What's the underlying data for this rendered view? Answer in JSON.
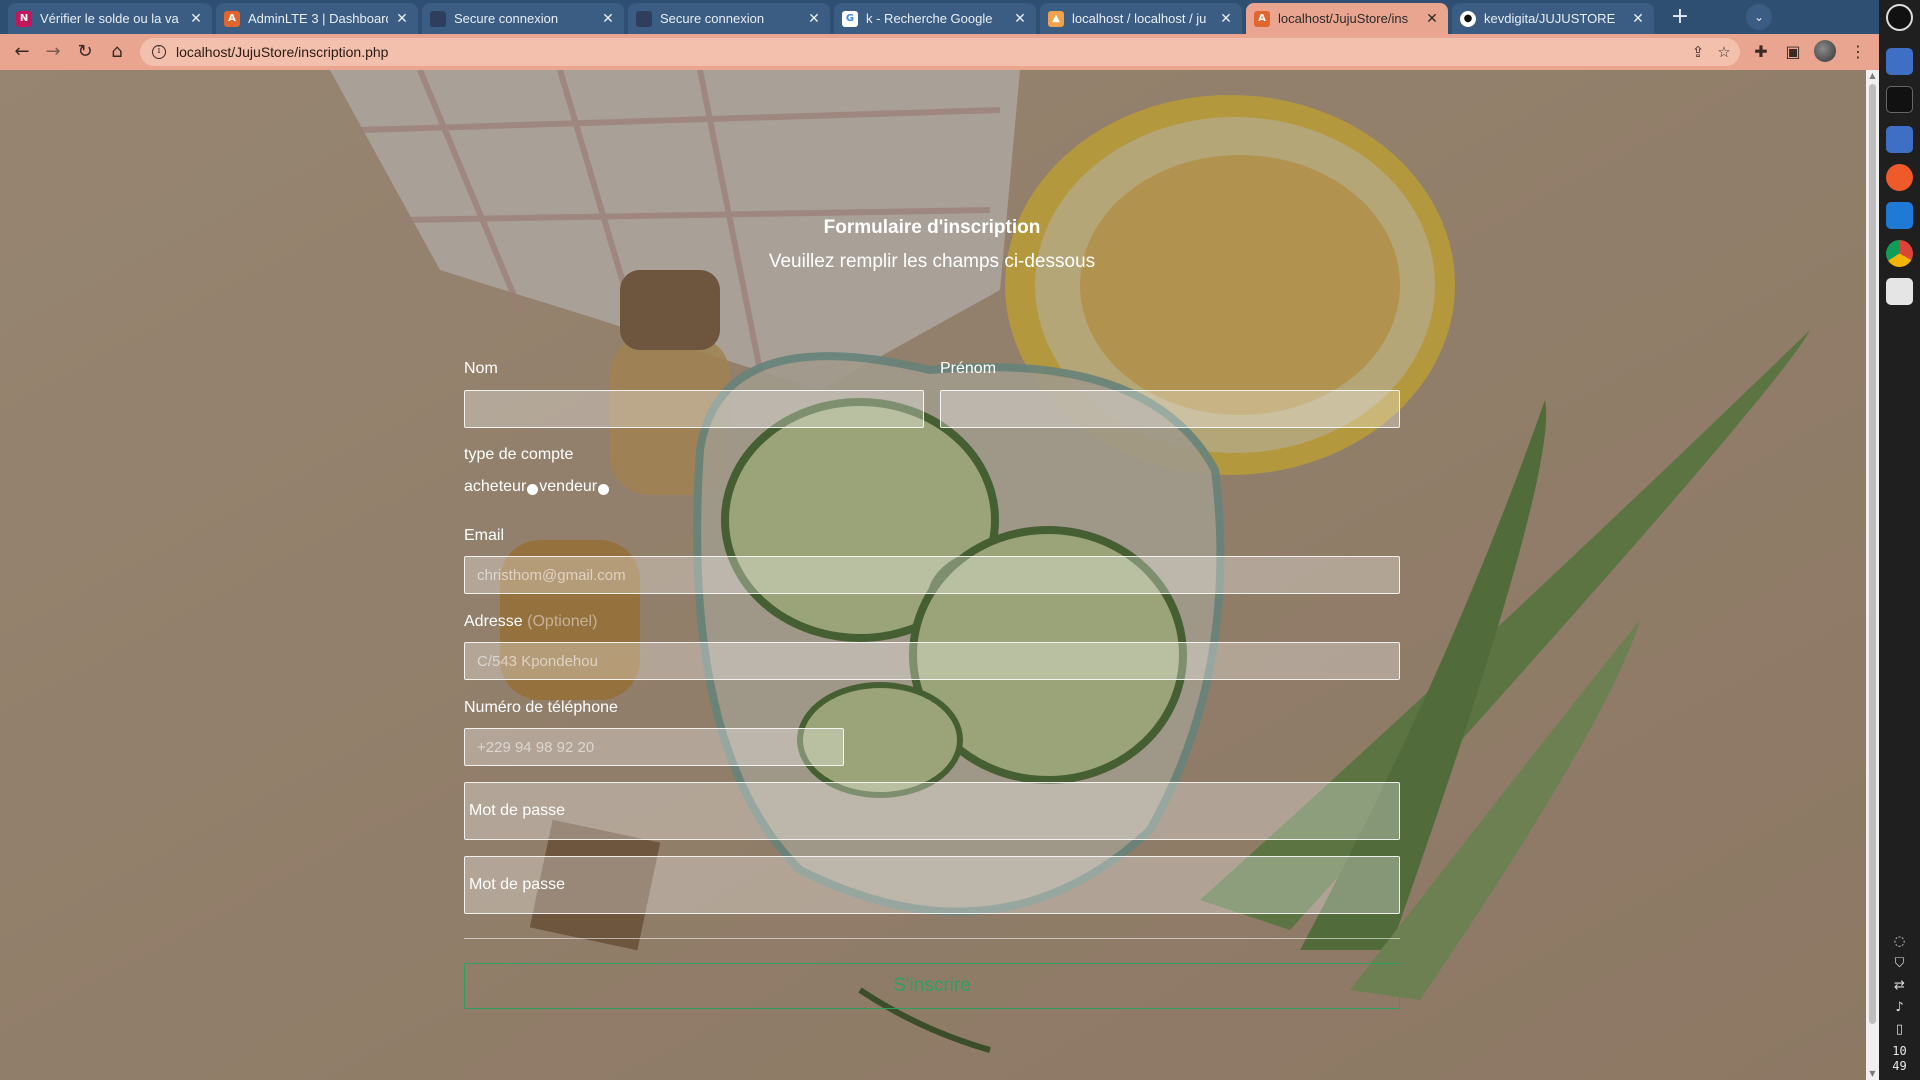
{
  "browser": {
    "tabs": [
      {
        "title": "Vérifier le solde ou la va",
        "icon": "n-icon",
        "color": "#c2185b"
      },
      {
        "title": "AdminLTE 3 | Dashboard",
        "icon": "admin-icon",
        "color": "#e0652f"
      },
      {
        "title": "Secure connexion",
        "icon": "doc-icon",
        "color": "#2f3e5c"
      },
      {
        "title": "Secure connexion",
        "icon": "doc-icon",
        "color": "#2f3e5c"
      },
      {
        "title": "k - Recherche Google",
        "icon": "google-icon",
        "color": "#ffffff"
      },
      {
        "title": "localhost / localhost / ju",
        "icon": "phpmyadmin-icon",
        "color": "#f1a14b"
      },
      {
        "title": "localhost/JujuStore/ins",
        "icon": "admin-icon",
        "color": "#e0652f"
      },
      {
        "title": "kevdigita/JUJUSTORE",
        "icon": "github-icon",
        "color": "#ffffff"
      }
    ],
    "url": "localhost/JujuStore/inscription.php"
  },
  "clock": {
    "hour": "10",
    "minute": "49"
  },
  "form": {
    "title": "Formulaire d'inscription",
    "subtitle": "Veuillez remplir les champs ci-dessous",
    "nom_label": "Nom",
    "nom_value": "",
    "prenom_label": "Prénom",
    "prenom_value": "",
    "account_type_label": "type de compte",
    "account_options": [
      "acheteur",
      "vendeur"
    ],
    "email_label": "Email",
    "email_placeholder": "christhom@gmail.com",
    "adresse_label": "Adresse",
    "adresse_optional": "(Optionel)",
    "adresse_placeholder": "C/543 Kpondehou",
    "phone_label": "Numéro de téléphone",
    "phone_placeholder": "+229 94 98 92 20",
    "password_placeholder": "Mot de passe",
    "password_confirm_placeholder": "Mot de passe",
    "submit_label": "S'inscrire"
  },
  "colors": {
    "tab_bar": "#2f4f72",
    "toolbar": "#e9a58f",
    "submit_accent": "#2e9e63"
  }
}
